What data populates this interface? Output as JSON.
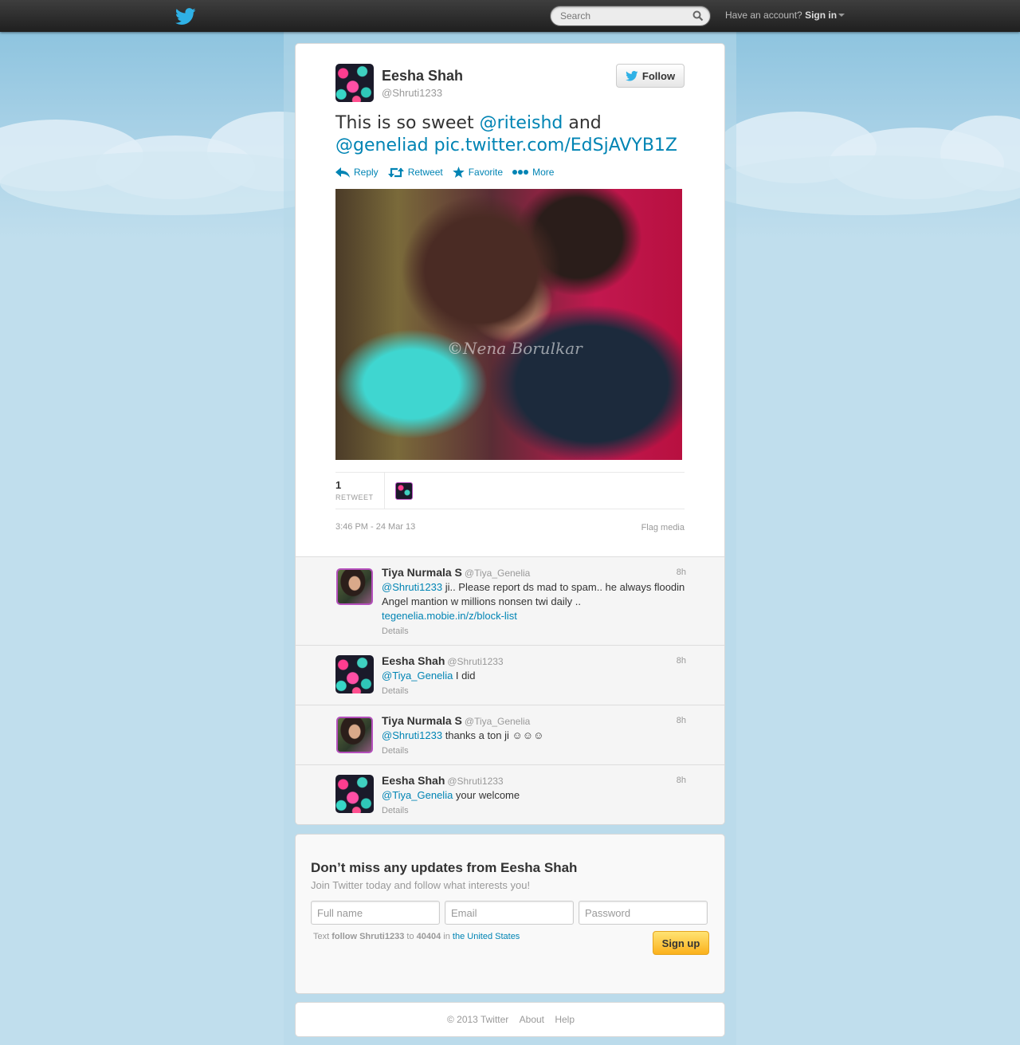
{
  "topbar": {
    "search_placeholder": "Search",
    "account_text": "Have an account?",
    "sign_in": "Sign in"
  },
  "tweet": {
    "author_name": "Eesha Shah",
    "author_handle": "@Shruti1233",
    "follow_label": "Follow",
    "text_prefix": "This is so sweet ",
    "mention1": "@riteishd",
    "text_mid": " and",
    "mention2": "@geneliad",
    "link": "pic.twitter.com/EdSjAVYB1Z",
    "actions": {
      "reply": "Reply",
      "retweet": "Retweet",
      "favorite": "Favorite",
      "more": "More"
    },
    "photo_watermark": "©Nena Borulkar",
    "retweet_count": "1",
    "retweet_label": "RETWEET",
    "timestamp": "3:46 PM - 24 Mar 13",
    "flag_media": "Flag media"
  },
  "replies": [
    {
      "name": "Tiya Nurmala S",
      "handle": "@Tiya_Genelia",
      "time": "8h",
      "mention": "@Shruti1233",
      "text": " ji.. Please report ds mad to spam.. he always floodin Angel mantion w millions nonsen twi daily ..",
      "link": "tegenelia.mobie.in/z/block-list",
      "details": "Details"
    },
    {
      "name": "Eesha Shah",
      "handle": "@Shruti1233",
      "time": "8h",
      "mention": "@Tiya_Genelia",
      "text": " I did",
      "details": "Details"
    },
    {
      "name": "Tiya Nurmala S",
      "handle": "@Tiya_Genelia",
      "time": "8h",
      "mention": "@Shruti1233",
      "text": " thanks a ton ji ☺☺☺",
      "details": "Details"
    },
    {
      "name": "Eesha Shah",
      "handle": "@Shruti1233",
      "time": "8h",
      "mention": "@Tiya_Genelia",
      "text": " your welcome",
      "details": "Details"
    }
  ],
  "signup": {
    "title": "Don’t miss any updates from Eesha Shah",
    "subtitle": "Join Twitter today and follow what interests you!",
    "fullname_placeholder": "Full name",
    "email_placeholder": "Email",
    "password_placeholder": "Password",
    "sms_text": "Text",
    "sms_command": "follow Shruti1233",
    "sms_to": "to",
    "sms_number": "40404",
    "sms_in": "in",
    "sms_country": "the United States",
    "signup_label": "Sign up"
  },
  "footer": {
    "copyright": "© 2013 Twitter",
    "about": "About",
    "help": "Help"
  },
  "colors": {
    "link": "#0084b4",
    "background": "#c0deed",
    "topbar": "#2a2a2a",
    "signup_button": "#fbb11c"
  }
}
